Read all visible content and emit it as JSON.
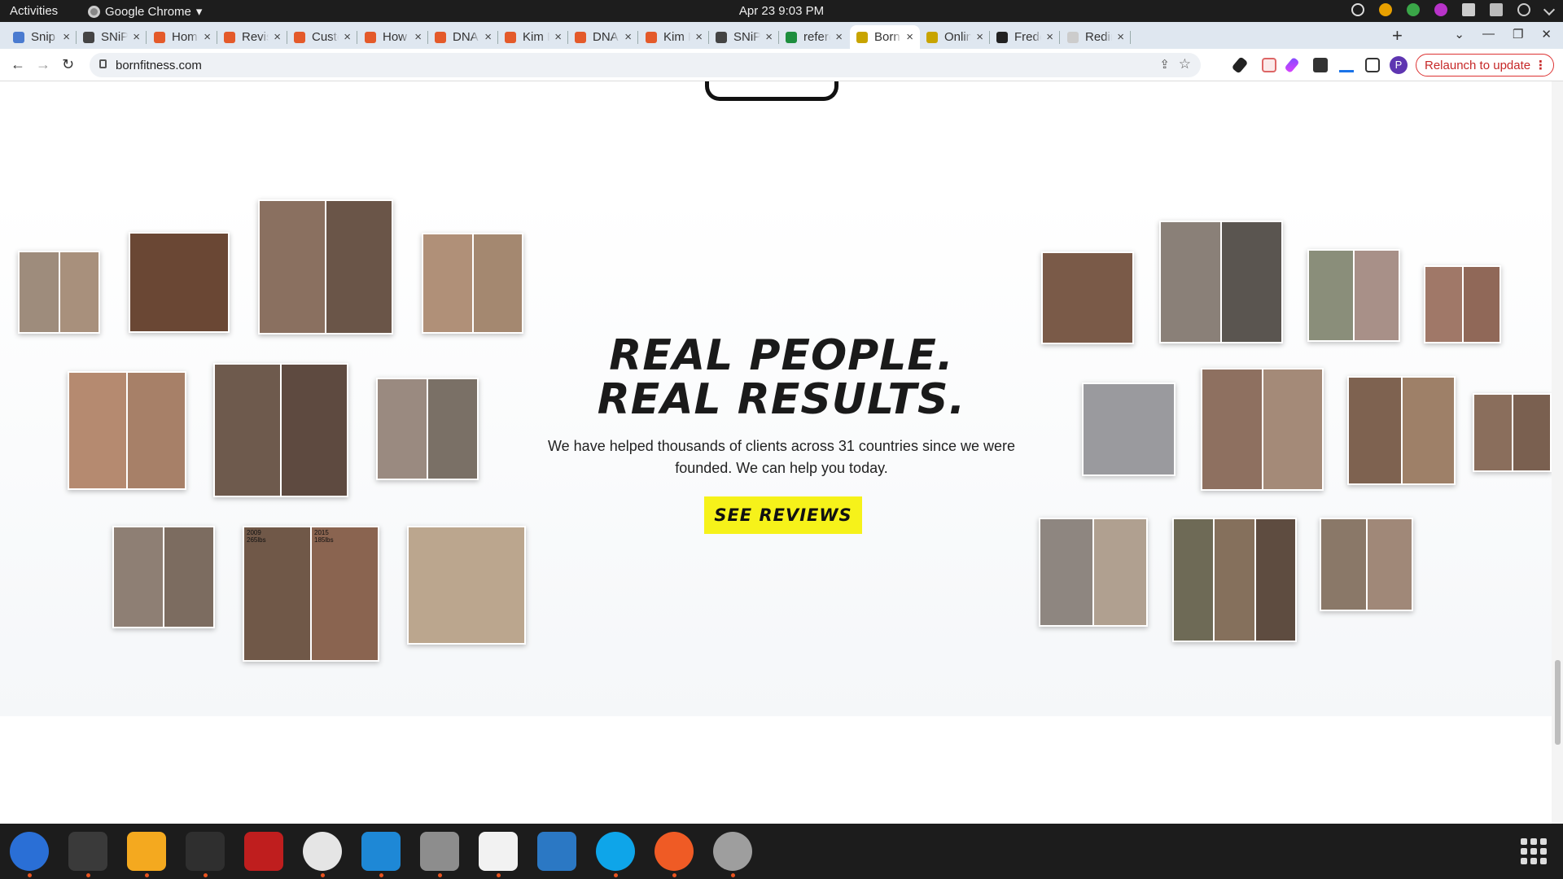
{
  "system_bar": {
    "activities": "Activities",
    "app_name": "Google Chrome",
    "app_arrow": "▾",
    "clock": "Apr 23  9:03 PM"
  },
  "tabs": [
    {
      "title": "Snip D",
      "favicon_color": "#4a7bd0"
    },
    {
      "title": "SNiP N",
      "favicon_color": "#444444"
    },
    {
      "title": "Home",
      "favicon_color": "#e45a2a"
    },
    {
      "title": "Revise",
      "favicon_color": "#e45a2a"
    },
    {
      "title": "Custo",
      "favicon_color": "#e45a2a"
    },
    {
      "title": "How D",
      "favicon_color": "#e45a2a"
    },
    {
      "title": "DNA F",
      "favicon_color": "#e45a2a"
    },
    {
      "title": "Kim Re",
      "favicon_color": "#e45a2a"
    },
    {
      "title": "DNA F",
      "favicon_color": "#e45a2a"
    },
    {
      "title": "Kim Re",
      "favicon_color": "#e45a2a"
    },
    {
      "title": "SNiP N",
      "favicon_color": "#444444"
    },
    {
      "title": "refere",
      "favicon_color": "#1e8e3e"
    },
    {
      "title": "Born F",
      "favicon_color": "#c8a400"
    },
    {
      "title": "Online",
      "favicon_color": "#c8a400"
    },
    {
      "title": "Frede",
      "favicon_color": "#222222"
    },
    {
      "title": "Redire",
      "favicon_color": "#cccccc"
    }
  ],
  "active_tab_index": 12,
  "toolbar": {
    "url": "bornfitness.com",
    "relaunch_label": "Relaunch to update",
    "avatar_letter": "P"
  },
  "icons": {
    "back": "←",
    "forward": "→",
    "reload": "↻",
    "share": "⇪",
    "star": "☆",
    "close": "×",
    "new_tab": "+",
    "tab_search": "⌄",
    "minimize": "—",
    "restore": "❐",
    "window_close": "✕",
    "menu": "⋮"
  },
  "content": {
    "headline_line1": "REAL PEOPLE.",
    "headline_line2": "REAL RESULTS.",
    "subtext": "We have helped thousands of clients across 31 countries since we were founded. We can help you today.",
    "cta_label": "SEE REVIEWS",
    "cta_color": "#f6f21a"
  },
  "photo_labels": {
    "before_year": "2009",
    "before_weight": "265lbs",
    "after_year": "2015",
    "after_weight": "185lbs"
  },
  "dock": [
    {
      "name": "thunderbird-icon",
      "color": "#2a6fd6",
      "running": true
    },
    {
      "name": "terminal-icon",
      "color": "#3a3a3a",
      "running": true
    },
    {
      "name": "calculator-icon",
      "color": "#f4a91f",
      "running": true
    },
    {
      "name": "system-monitor-icon",
      "color": "#2f2f2f",
      "running": true
    },
    {
      "name": "filezilla-icon",
      "color": "#bf1e1e",
      "running": false
    },
    {
      "name": "chrome-icon",
      "color": "#e5e5e5",
      "running": true
    },
    {
      "name": "vscode-icon",
      "color": "#1e88d6",
      "running": true
    },
    {
      "name": "files-icon",
      "color": "#8d8d8d",
      "running": true
    },
    {
      "name": "text-editor-icon",
      "color": "#f2f2f2",
      "running": true
    },
    {
      "name": "libreoffice-writer-icon",
      "color": "#2b78c4",
      "running": false
    },
    {
      "name": "skype-icon",
      "color": "#0ea5e9",
      "running": true
    },
    {
      "name": "postman-icon",
      "color": "#ef5b25",
      "running": true
    },
    {
      "name": "disk-utility-icon",
      "color": "#9e9e9e",
      "running": true
    }
  ]
}
